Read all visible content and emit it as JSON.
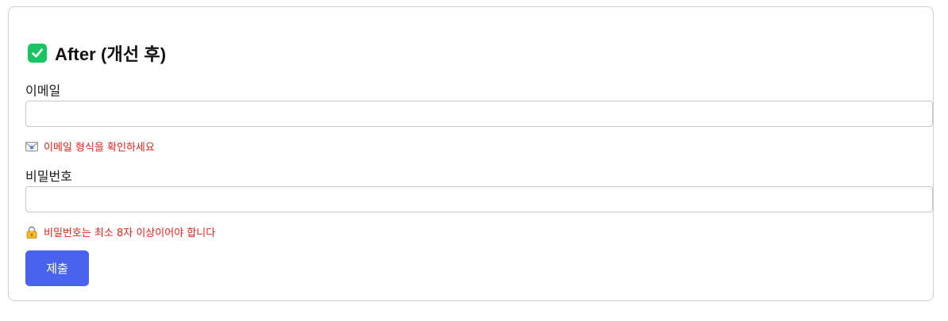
{
  "heading": {
    "icon": "check-mark-button-icon",
    "text": "After (개선 후)"
  },
  "email": {
    "label": "이메일",
    "value": "",
    "placeholder": "",
    "hint_icon": "envelope-icon",
    "hint": "이메일 형식을 확인하세요"
  },
  "password": {
    "label": "비밀번호",
    "value": "",
    "placeholder": "",
    "hint_icon": "lock-icon",
    "hint": "비밀번호는 최소 8자 이상이어야 합니다"
  },
  "submit": {
    "label": "제출"
  },
  "colors": {
    "accent": "#4a63ee",
    "error": "#e2231a",
    "success": "#19c463"
  }
}
